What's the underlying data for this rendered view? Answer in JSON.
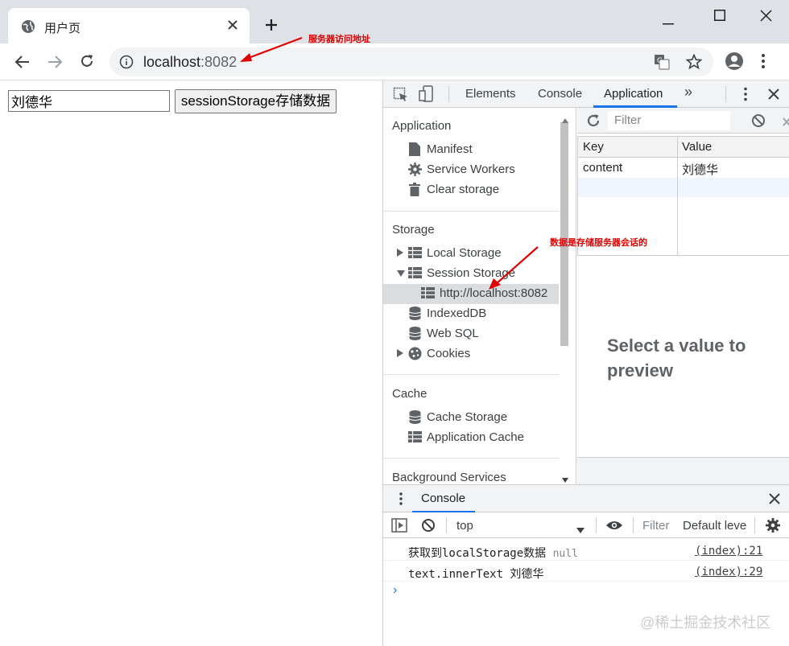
{
  "browser": {
    "tab_title": "用户页",
    "url_host": "localhost",
    "url_port": ":8082"
  },
  "page": {
    "input_value": "刘德华",
    "button_label": "sessionStorage存储数据"
  },
  "devtools": {
    "tabs": [
      "Elements",
      "Console",
      "Application",
      "»"
    ],
    "active_tab": "Application",
    "sidebar": {
      "application_header": "Application",
      "application_items": [
        "Manifest",
        "Service Workers",
        "Clear storage"
      ],
      "storage_header": "Storage",
      "storage_items": [
        "Local Storage",
        "Session Storage",
        "http://localhost:8082",
        "IndexedDB",
        "Web SQL",
        "Cookies"
      ],
      "cache_header": "Cache",
      "cache_items": [
        "Cache Storage",
        "Application Cache"
      ],
      "background_header": "Background Services"
    },
    "filter_placeholder": "Filter",
    "table": {
      "headers": [
        "Key",
        "Value"
      ],
      "rows": [
        [
          "content",
          "刘德华"
        ]
      ]
    },
    "preview_text": "Select a value to preview"
  },
  "console": {
    "drawer_tab": "Console",
    "context": "top",
    "filter_placeholder": "Filter",
    "levels": "Default leve",
    "logs": [
      {
        "message": "获取到localStorage数据",
        "extra": "null",
        "source": "(index):21"
      },
      {
        "message": "text.innerText 刘德华",
        "extra": "",
        "source": "(index):29"
      }
    ],
    "prompt": "›"
  },
  "annotations": {
    "url_note": "服务器访问地址",
    "storage_note": "数据是存储服务器会话的",
    "arrow_color": "#e00000"
  },
  "watermark": "@稀土掘金技术社区"
}
